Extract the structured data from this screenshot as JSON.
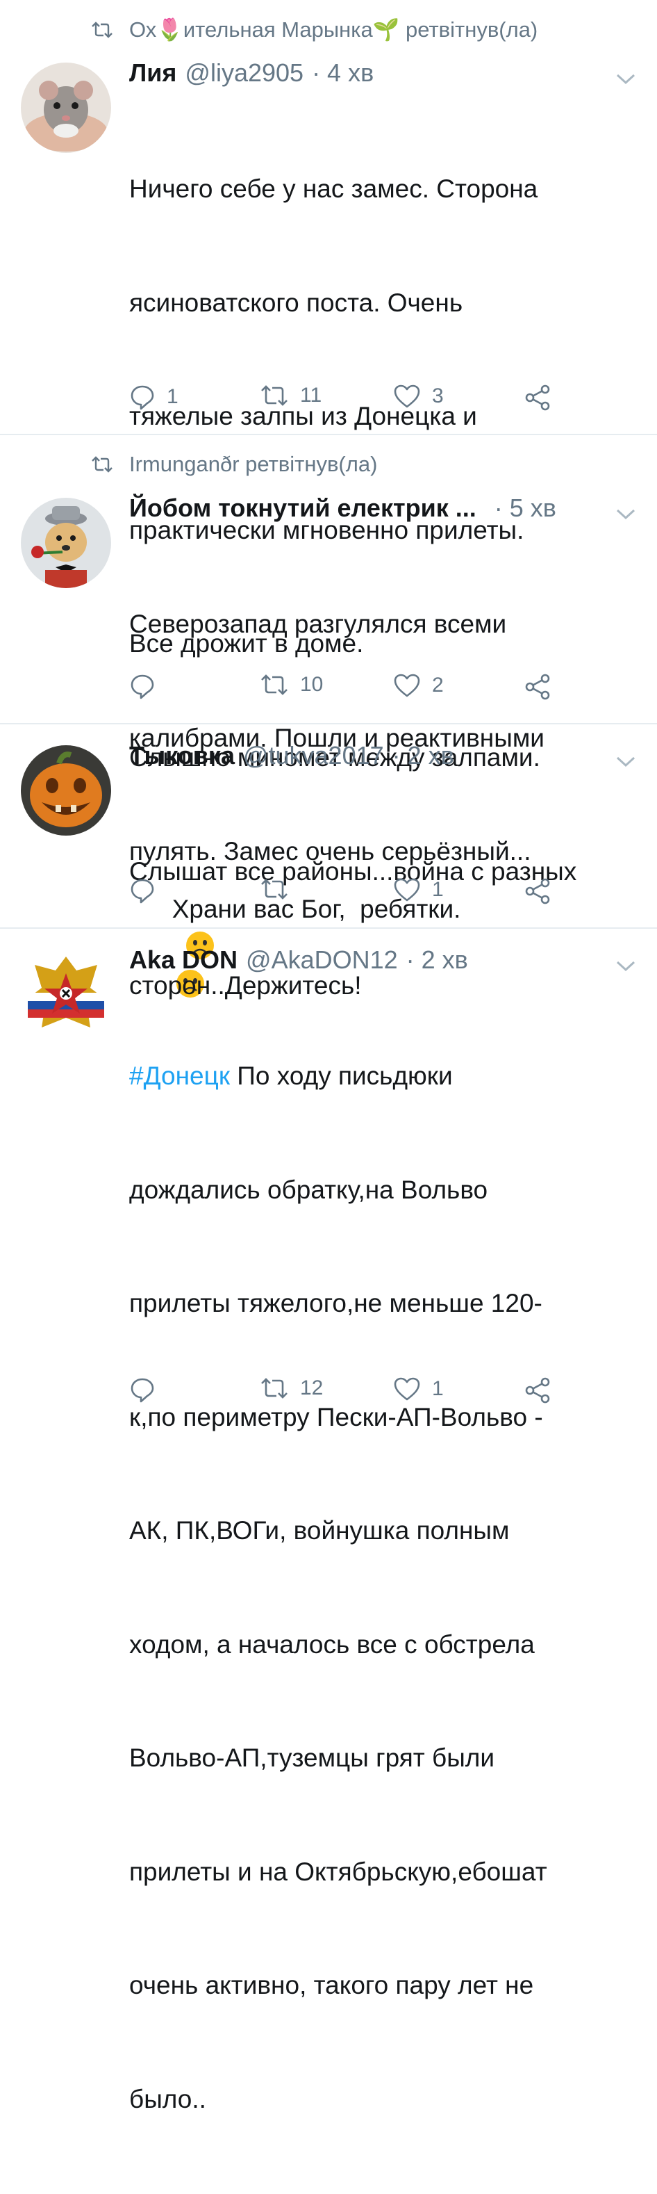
{
  "tweets": [
    {
      "retweeted_by": "Ох🌷ительная Марынка🌱 ретвітнув(ла)",
      "name": "Лия",
      "handle": "@liya2905",
      "time": "· 4 хв",
      "text_lines": [
        "Ничего себе у нас замес. Сторона",
        "ясиноватского поста. Очень",
        "тяжелые залпы из Донецка и",
        "практически мгновенно прилеты.",
        "Все дрожит в доме.",
        "Слышно миномет между залпами.",
        "Храни вас Бог,  ребятки."
      ],
      "emojis": [
        "worried-face-emoji",
        "worried-face-emoji"
      ],
      "replies": "1",
      "retweets": "11",
      "likes": "3"
    },
    {
      "retweeted_by": "Irmunganðr ретвітнув(ла)",
      "name": "Йобом токнутий  електрик ...",
      "handle": "",
      "time": "· 5 хв",
      "text_lines": [
        "Северозапад разгулялся всеми",
        "калибрами. Пошли и реактивными",
        "пулять. Замес очень серьёзный..."
      ],
      "replies": "",
      "retweets": "10",
      "likes": "2"
    },
    {
      "retweeted_by": "",
      "name": "Тыковка",
      "handle": "@tukva2017",
      "time": "· 2 хв",
      "text_lines": [
        "Слышат все районы...война с разных",
        "сторон..Держитесь!"
      ],
      "replies": "",
      "retweets": "",
      "likes": "1"
    },
    {
      "retweeted_by": "",
      "name": "Aka DON",
      "handle": "@AkaDON12",
      "time": "· 2 хв",
      "hashtag": "#Донецк",
      "text_first_line_rest": " По ходу письдюки",
      "text_lines": [
        "дождались обратку,на Вольво",
        "прилеты тяжелого,не меньше 120-",
        "к,по периметру Пески-АП-Вольво -",
        "АК, ПК,ВОГи, войнушка полным",
        "ходом, а началось все с обстрела",
        "Вольво-АП,туземцы грят были",
        "прилеты и на Октябрьскую,ебошат",
        "очень активно, такого пару лет не",
        "было.."
      ],
      "replies": "",
      "retweets": "12",
      "likes": "1"
    }
  ],
  "colors": {
    "text": "#14171a",
    "secondary": "#657786",
    "link": "#1da1f2",
    "divider": "#e6ecf0"
  },
  "icons": {
    "reply": "reply-icon",
    "retweet": "retweet-icon",
    "like": "heart-icon",
    "share": "share-icon",
    "more": "chevron-down-icon"
  }
}
